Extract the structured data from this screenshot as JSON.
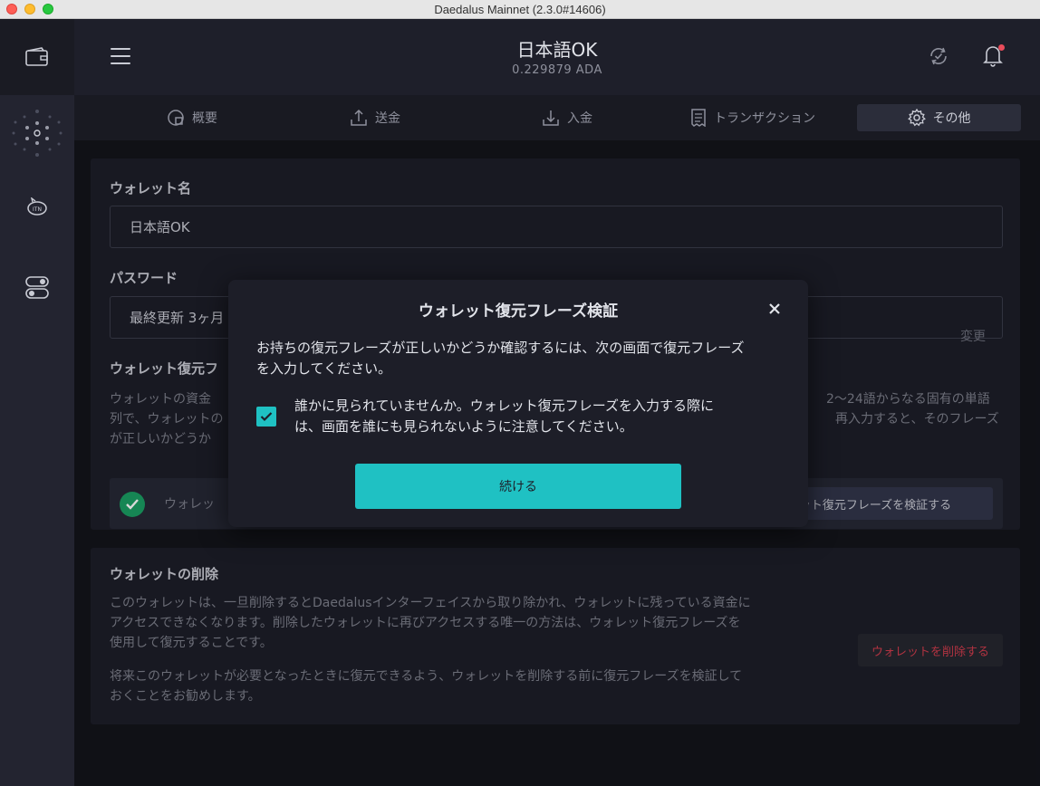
{
  "window": {
    "title": "Daedalus Mainnet (2.3.0#14606)"
  },
  "topbar": {
    "wallet_name": "日本語OK",
    "wallet_amount": "0.229879 ADA"
  },
  "tabs": [
    {
      "label": "概要",
      "icon": "summary-icon"
    },
    {
      "label": "送金",
      "icon": "send-icon"
    },
    {
      "label": "入金",
      "icon": "receive-icon"
    },
    {
      "label": "トランザクション",
      "icon": "transactions-icon"
    },
    {
      "label": "その他",
      "icon": "gear-icon",
      "active": true
    }
  ],
  "settings": {
    "wallet_name_label": "ウォレット名",
    "wallet_name_value": "日本語OK",
    "password_label": "パスワード",
    "password_value": "最終更新 3ヶ月",
    "password_change": "変更",
    "recovery_label": "ウォレット復元フ",
    "recovery_desc_left_1": "ウォレットの資金",
    "recovery_desc_left_2": "列で、ウォレットの",
    "recovery_desc_left_3": "が正しいかどうか",
    "recovery_desc_right_1": "2〜24語からなる固有の単語",
    "recovery_desc_right_2": "再入力すると、そのフレーズ",
    "verify_status_text": "ウォレッ",
    "verify_button": "ット復元フレーズを検証する"
  },
  "delete": {
    "label": "ウォレットの削除",
    "desc_1": "このウォレットは、一旦削除するとDaedalusインターフェイスから取り除かれ、ウォレットに残っている資金に",
    "desc_2": "アクセスできなくなります。削除したウォレットに再びアクセスする唯一の方法は、ウォレット復元フレーズを",
    "desc_3": "使用して復元することです。",
    "desc_4": "将来このウォレットが必要となったときに復元できるよう、ウォレットを削除する前に復元フレーズを検証して",
    "desc_5": "おくことをお勧めします。",
    "button": "ウォレットを削除する"
  },
  "dialog": {
    "title": "ウォレット復元フレーズ検証",
    "body_1": "お持ちの復元フレーズが正しいかどうか確認するには、次の画面で復元フレーズ",
    "body_2": "を入力してください。",
    "check_text_1": "誰かに見られていませんか。ウォレット復元フレーズを入力する際に",
    "check_text_2": "は、画面を誰にも見られないように注意してください。",
    "continue_button": "続ける"
  },
  "colors": {
    "accent": "#1fc1c3",
    "danger": "#d13c4d",
    "success": "#1b9e63",
    "notification": "#ea4c5b"
  }
}
